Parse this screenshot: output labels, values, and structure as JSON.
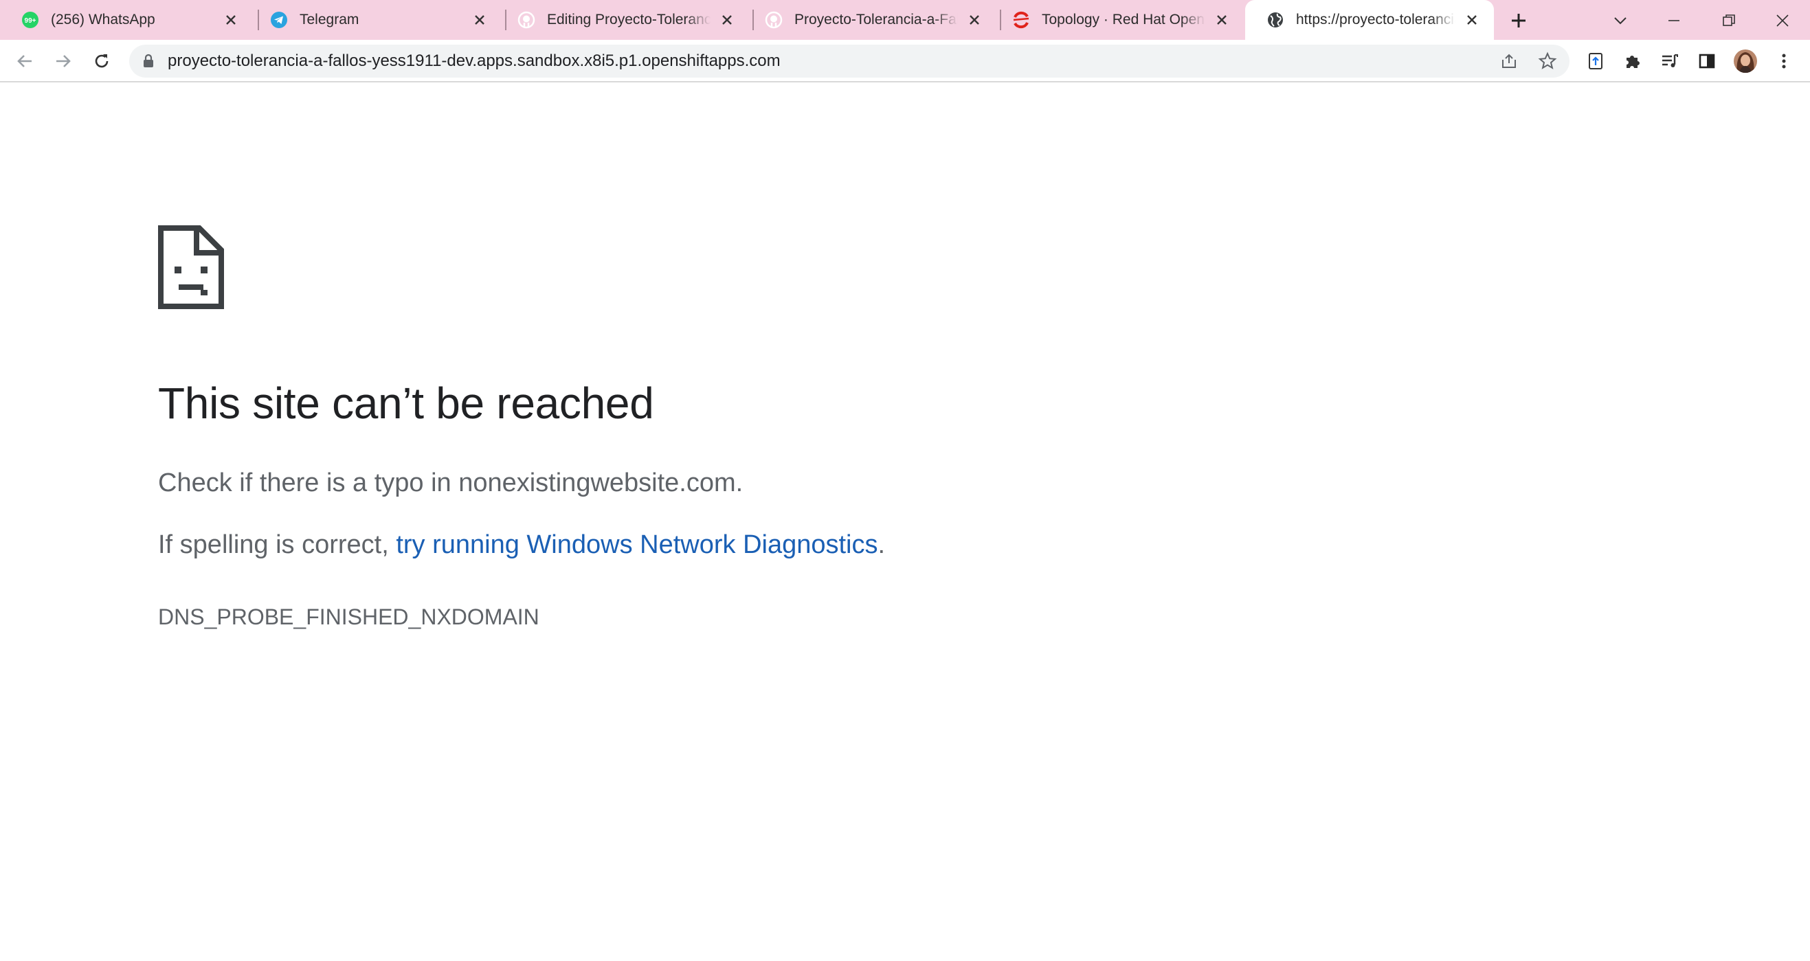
{
  "browser": {
    "tabs": [
      {
        "title": "(256) WhatsApp",
        "icon": "whatsapp-icon",
        "badge": "99+",
        "active": false
      },
      {
        "title": "Telegram",
        "icon": "telegram-icon",
        "active": false
      },
      {
        "title": "Editing Proyecto-Tolerancia-a-Fallos",
        "icon": "github-icon",
        "active": false
      },
      {
        "title": "Proyecto-Tolerancia-a-Fallos",
        "icon": "github-icon",
        "active": false
      },
      {
        "title": "Topology · Red Hat OpenShift",
        "icon": "openshift-icon",
        "active": false
      },
      {
        "title": "https://proyecto-tolerancia-a-fallos",
        "icon": "globe-icon",
        "active": true
      }
    ],
    "new_tab_label": "+",
    "address_bar": {
      "url": "proyecto-tolerancia-a-fallos-yess1911-dev.apps.sandbox.x8i5.p1.openshiftapps.com"
    }
  },
  "error_page": {
    "title": "This site can’t be reached",
    "line1": "Check if there is a typo in nonexistingwebsite.com.",
    "line2_prefix": "If spelling is correct, ",
    "line2_link": "try running Windows Network Diagnostics",
    "line2_suffix": ".",
    "error_code": "DNS_PROBE_FINISHED_NXDOMAIN"
  },
  "colors": {
    "tabstrip_bg": "#f5d1e1",
    "link": "#1a5fb4",
    "text_secondary": "#5f6368",
    "whatsapp": "#25d366",
    "telegram": "#2aa3df",
    "openshift": "#e0231c"
  }
}
